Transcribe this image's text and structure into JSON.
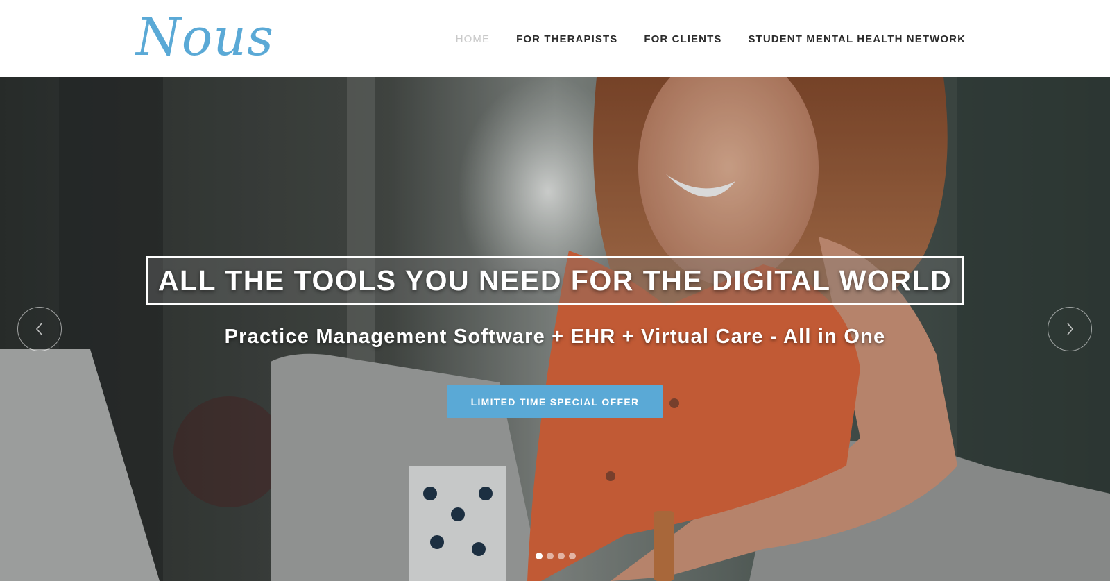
{
  "brand": {
    "logo_text": "Nous",
    "logo_color": "#5aa9d6"
  },
  "nav": {
    "items": [
      {
        "label": "HOME",
        "active": true
      },
      {
        "label": "FOR THERAPISTS",
        "active": false
      },
      {
        "label": "FOR CLIENTS",
        "active": false
      },
      {
        "label": "STUDENT MENTAL HEALTH NETWORK",
        "active": false
      }
    ]
  },
  "hero": {
    "headline": "ALL THE TOOLS YOU NEED FOR THE DIGITAL WORLD",
    "subheadline": "Practice Management Software + EHR + Virtual Care - All in One",
    "cta_label": "LIMITED TIME SPECIAL OFFER",
    "cta_color": "#5aa9d6",
    "prev_icon": "chevron-left-icon",
    "next_icon": "chevron-right-icon",
    "slides_total": 4,
    "active_slide": 1
  }
}
